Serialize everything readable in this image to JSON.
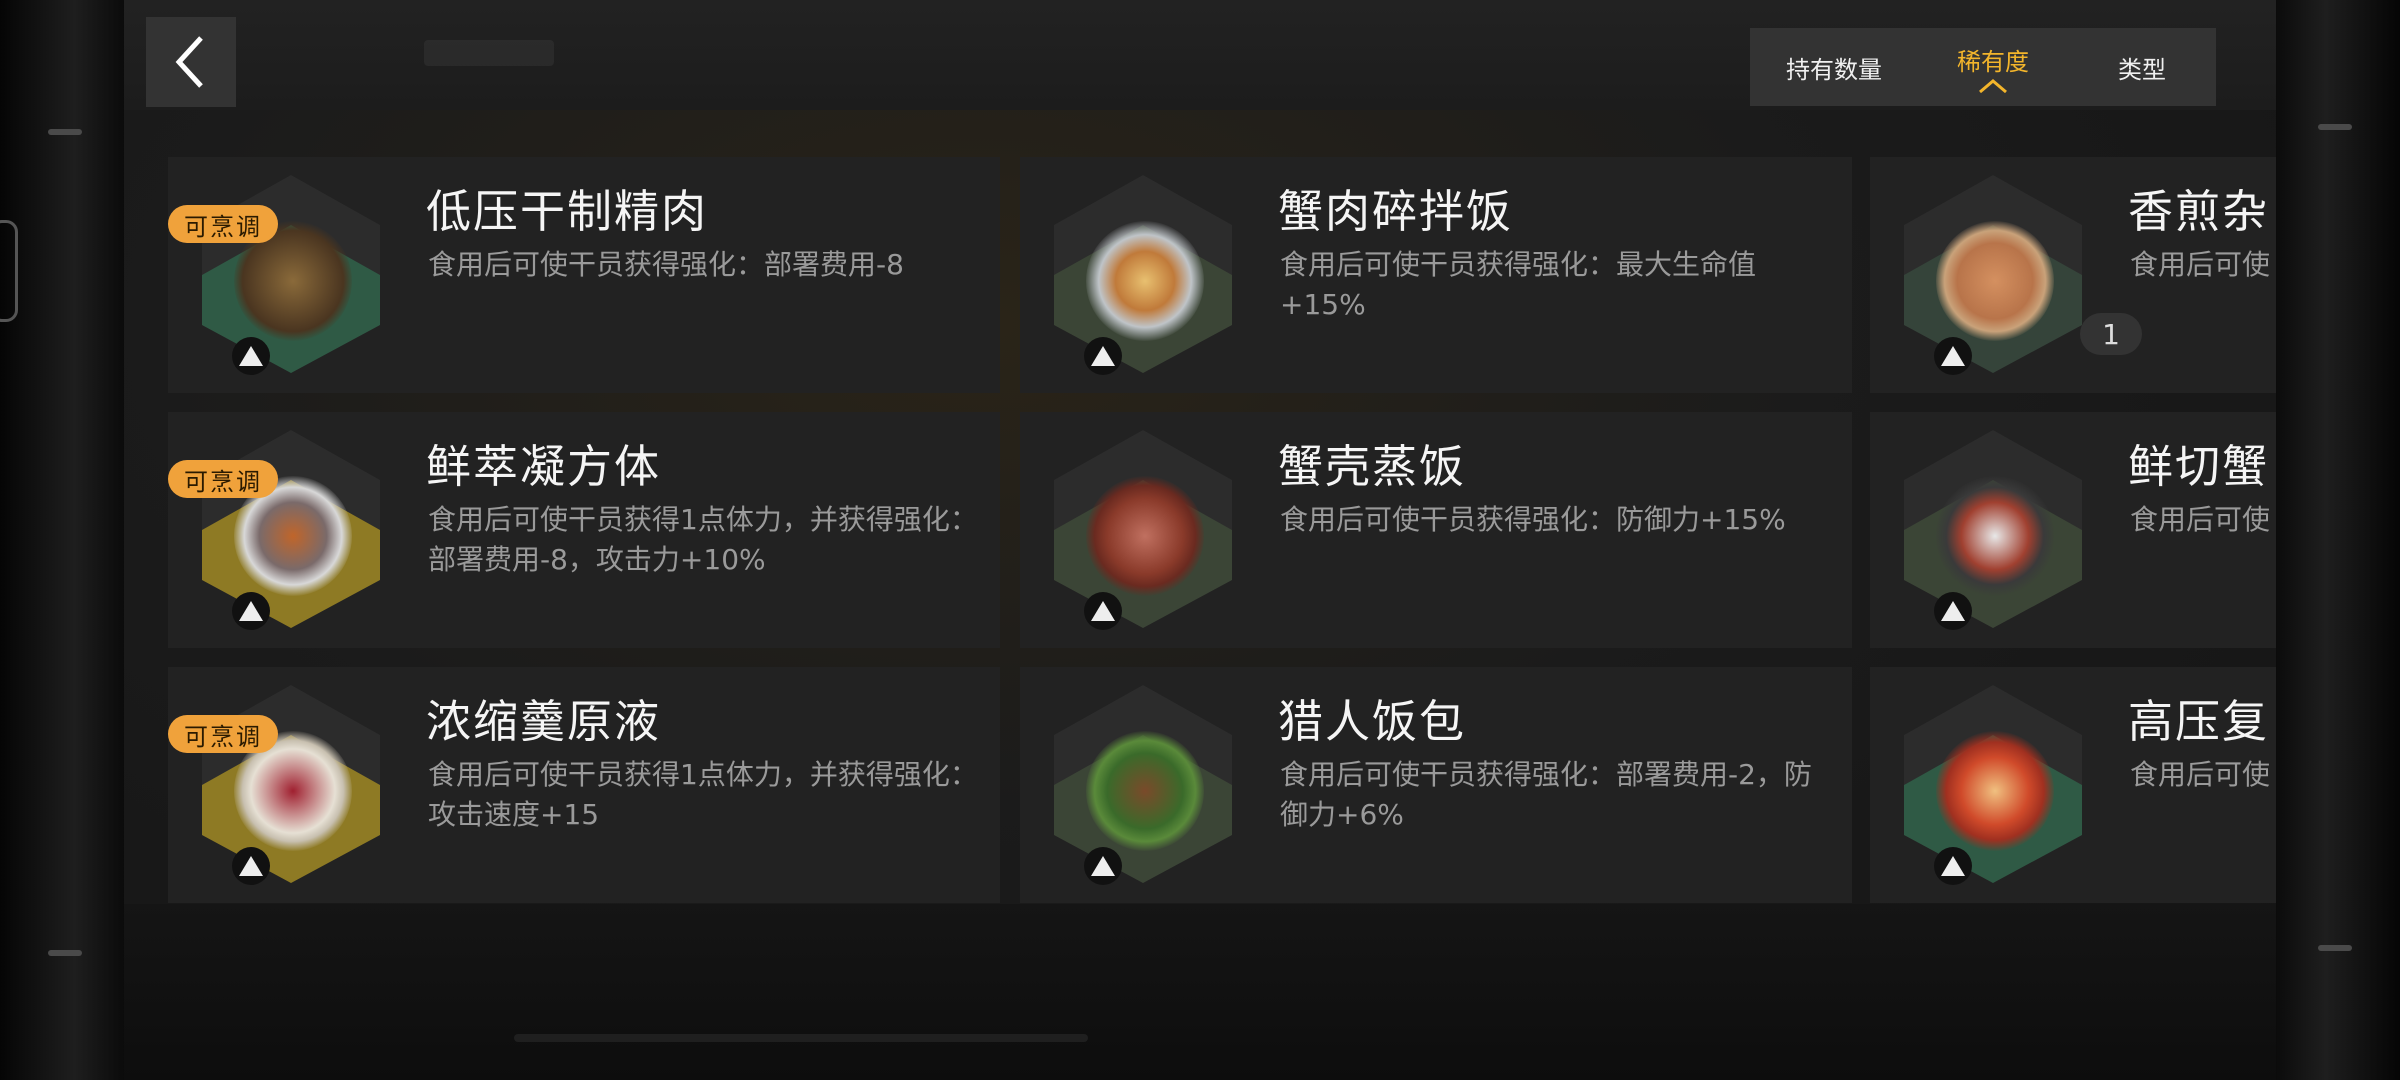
{
  "header": {
    "back_label": "返回"
  },
  "sort": {
    "items": [
      {
        "label": "持有数量",
        "active": false
      },
      {
        "label": "稀有度",
        "active": true
      },
      {
        "label": "类型",
        "active": false
      }
    ],
    "active_color": "#f3b52b"
  },
  "cards": [
    {
      "name": "低压干制精肉",
      "desc": "食用后可使干员获得强化：部署费用-8",
      "tag": "可烹调",
      "tile_color": "#2f5a45",
      "rarity_icon": "rarity-triangle-icon",
      "food_icon": "dried-meat-icon"
    },
    {
      "name": "蟹肉碎拌饭",
      "desc": "食用后可使干员获得强化：最大生命值+15%",
      "tile_color": "#3b4536",
      "rarity_icon": "rarity-triangle-icon",
      "food_icon": "crab-rice-icon"
    },
    {
      "name": "香煎杂",
      "desc": "食用后可使",
      "count": "1",
      "tile_color": "#35443a",
      "rarity_icon": "rarity-triangle-icon",
      "food_icon": "fried-mix-icon"
    },
    {
      "name": "鲜萃凝方体",
      "desc": "食用后可使干员获得1点体力，并获得强化：部署费用-8，攻击力+10%",
      "tag": "可烹调",
      "tile_color": "#8e7a24",
      "rarity_icon": "rarity-triangle-icon",
      "food_icon": "cube-icon"
    },
    {
      "name": "蟹壳蒸饭",
      "desc": "食用后可使干员获得强化：防御力+15%",
      "tile_color": "#3b4536",
      "rarity_icon": "rarity-triangle-icon",
      "food_icon": "crab-shell-icon"
    },
    {
      "name": "鲜切蟹",
      "desc": "食用后可使",
      "tile_color": "#3b4536",
      "rarity_icon": "rarity-triangle-icon",
      "food_icon": "bento-icon"
    },
    {
      "name": "浓缩羹原液",
      "desc": "食用后可使干员获得1点体力，并获得强化：攻击速度+15",
      "tag": "可烹调",
      "tile_color": "#8e7a24",
      "rarity_icon": "rarity-triangle-icon",
      "food_icon": "blender-icon"
    },
    {
      "name": "猎人饭包",
      "desc": "食用后可使干员获得强化：部署费用-2，防御力+6%",
      "tile_color": "#3b4536",
      "rarity_icon": "rarity-triangle-icon",
      "food_icon": "leaf-wrap-icon"
    },
    {
      "name": "高压复",
      "desc": "食用后可使",
      "tile_color": "#2f5a45",
      "rarity_icon": "rarity-triangle-icon",
      "food_icon": "pressure-cooker-icon"
    }
  ]
}
